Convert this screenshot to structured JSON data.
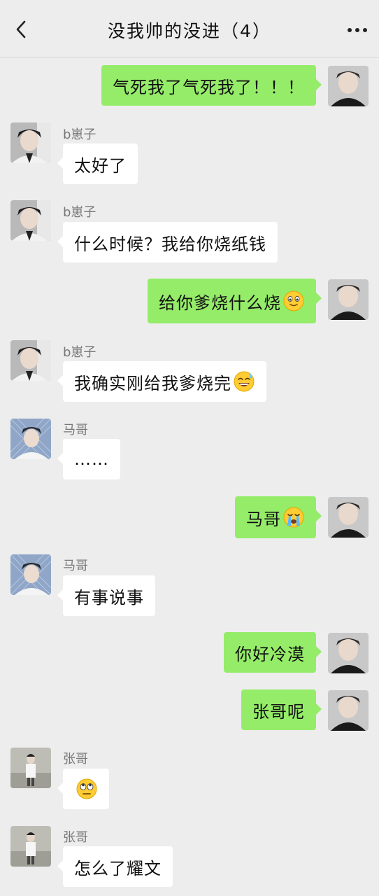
{
  "header": {
    "title": "没我帅的没进（4）",
    "back_icon": "chevron-left-icon",
    "more_icon": "more-dots-icon"
  },
  "colors": {
    "background": "#ededed",
    "outgoing_bubble": "#95ec69",
    "incoming_bubble": "#ffffff"
  },
  "messages": [
    {
      "direction": "out",
      "text": "气死我了气死我了！！！"
    },
    {
      "direction": "in",
      "sender": "b崽子",
      "text": "太好了"
    },
    {
      "direction": "in",
      "sender": "b崽子",
      "text": "什么时候？我给你烧纸钱"
    },
    {
      "direction": "out",
      "text": "给你爹烧什么烧",
      "emoji": "smile-emoji"
    },
    {
      "direction": "in",
      "sender": "b崽子",
      "text": "我确实刚给我爹烧完",
      "emoji": "sweat-smile-emoji"
    },
    {
      "direction": "in",
      "sender": "马哥",
      "text": "……"
    },
    {
      "direction": "out",
      "text": "马哥",
      "emoji": "crying-emoji"
    },
    {
      "direction": "in",
      "sender": "马哥",
      "text": "有事说事"
    },
    {
      "direction": "out",
      "text": "你好冷漠"
    },
    {
      "direction": "out",
      "text": "张哥呢"
    },
    {
      "direction": "in",
      "sender": "张哥",
      "text": "",
      "emoji": "eye-roll-emoji"
    },
    {
      "direction": "in",
      "sender": "张哥",
      "text": "怎么了耀文"
    }
  ]
}
